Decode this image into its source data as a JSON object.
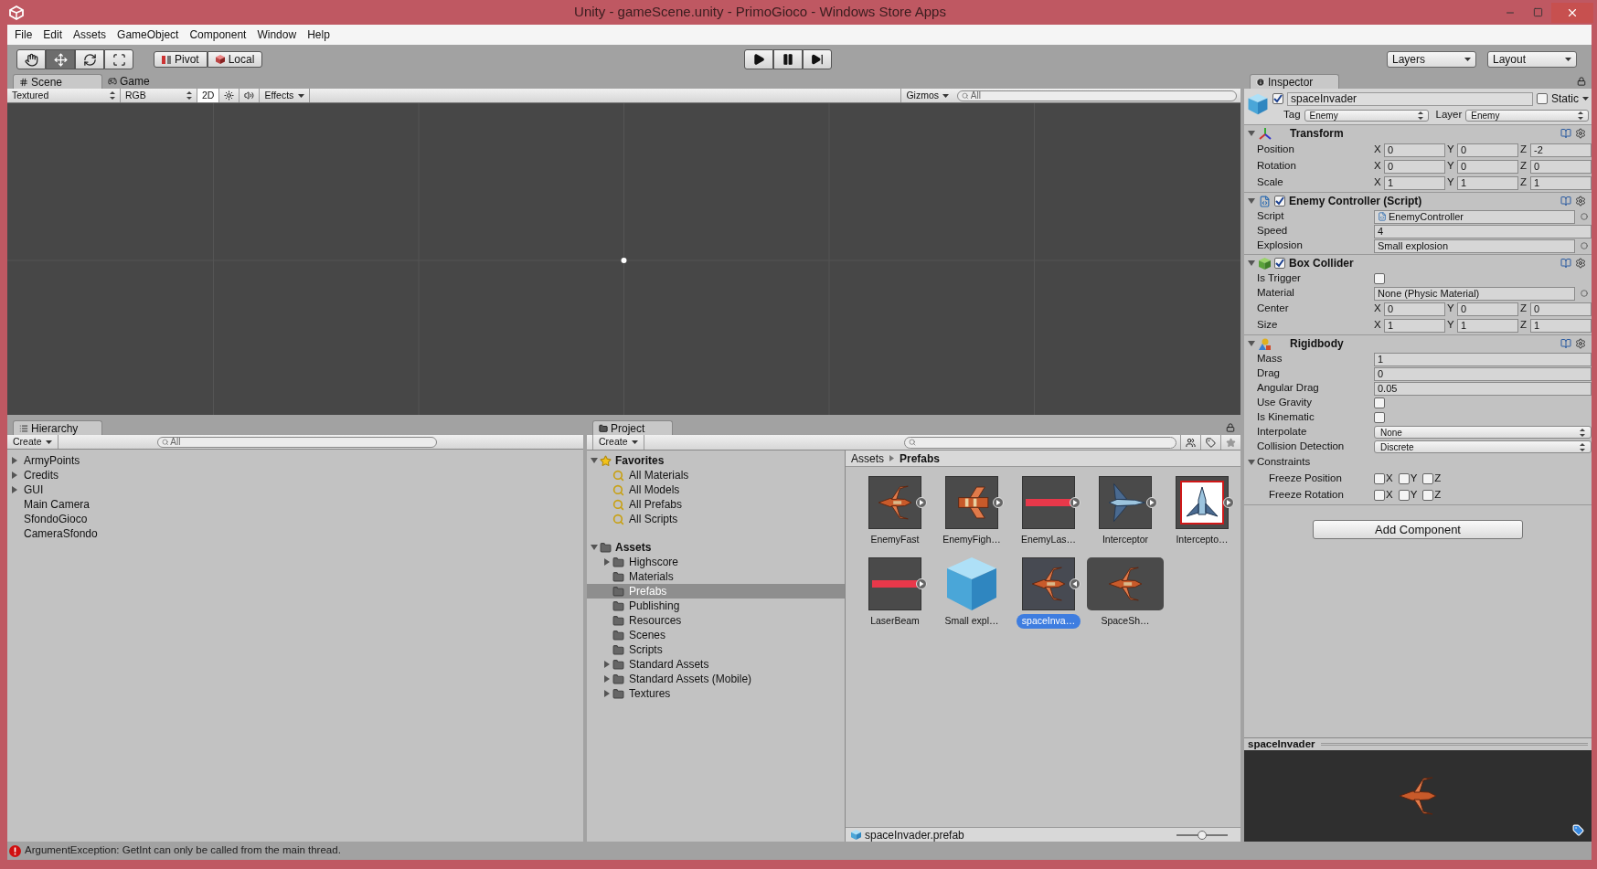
{
  "window": {
    "title": "Unity - gameScene.unity - PrimoGioco - Windows Store Apps"
  },
  "menu": [
    "File",
    "Edit",
    "Assets",
    "GameObject",
    "Component",
    "Window",
    "Help"
  ],
  "toolbar": {
    "tools": [
      {
        "kind": "hand",
        "selected": false
      },
      {
        "kind": "move",
        "selected": true
      },
      {
        "kind": "rotate",
        "selected": false
      },
      {
        "kind": "scale",
        "selected": false
      }
    ],
    "handles": [
      {
        "kind": "pivot",
        "label": "Pivot"
      },
      {
        "kind": "local",
        "label": "Local"
      }
    ],
    "playback": [
      {
        "kind": "play",
        "selected": false
      },
      {
        "kind": "pause",
        "selected": false
      },
      {
        "kind": "step",
        "selected": false
      }
    ],
    "layers": "Layers",
    "layout": "Layout"
  },
  "scene": {
    "tabs": [
      {
        "label": "Scene",
        "kind": "scene",
        "selected": true
      },
      {
        "label": "Game",
        "kind": "game",
        "selected": false
      }
    ],
    "shading": "Textured",
    "color_mode": "RGB",
    "mode_2d": {
      "label": "2D",
      "on": true
    },
    "lighting": {
      "on": false
    },
    "audio": {
      "on": false
    },
    "effects": "Effects",
    "gizmos": "Gizmos",
    "search_placeholder": "All"
  },
  "hierarchy": {
    "tab": "Hierarchy",
    "create": "Create",
    "search_placeholder": "All",
    "items": [
      {
        "label": "ArmyPoints",
        "has_children": true
      },
      {
        "label": "Credits",
        "has_children": true
      },
      {
        "label": "GUI",
        "has_children": true
      },
      {
        "label": "Main Camera",
        "has_children": false
      },
      {
        "label": "SfondoGioco",
        "has_children": false
      },
      {
        "label": "CameraSfondo",
        "has_children": false
      }
    ]
  },
  "project": {
    "tab": "Project",
    "create": "Create",
    "tree": [
      {
        "label": "Favorites",
        "kind": "favorites",
        "expanded": true,
        "children": [
          {
            "label": "All Materials",
            "kind": "search",
            "has_children": false,
            "selected": false
          },
          {
            "label": "All Models",
            "kind": "search",
            "has_children": false,
            "selected": false
          },
          {
            "label": "All Prefabs",
            "kind": "search",
            "has_children": false,
            "selected": false
          },
          {
            "label": "All Scripts",
            "kind": "search",
            "has_children": false,
            "selected": false
          }
        ]
      },
      {
        "label": "Assets",
        "kind": "folder",
        "expanded": true,
        "children": [
          {
            "label": "Highscore",
            "kind": "folder",
            "has_children": true,
            "selected": false
          },
          {
            "label": "Materials",
            "kind": "folder",
            "has_children": false,
            "selected": false
          },
          {
            "label": "Prefabs",
            "kind": "folder",
            "has_children": false,
            "selected": true
          },
          {
            "label": "Publishing",
            "kind": "folder",
            "has_children": false,
            "selected": false
          },
          {
            "label": "Resources",
            "kind": "folder",
            "has_children": false,
            "selected": false
          },
          {
            "label": "Scenes",
            "kind": "folder",
            "has_children": false,
            "selected": false
          },
          {
            "label": "Scripts",
            "kind": "folder",
            "has_children": false,
            "selected": false
          },
          {
            "label": "Standard Assets",
            "kind": "folder",
            "has_children": true,
            "selected": false
          },
          {
            "label": "Standard Assets (Mobile)",
            "kind": "folder",
            "has_children": true,
            "selected": false
          },
          {
            "label": "Textures",
            "kind": "folder",
            "has_children": true,
            "selected": false
          }
        ]
      }
    ],
    "breadcrumb": [
      "Assets",
      "Prefabs"
    ],
    "assets": [
      {
        "label": "EnemyFast",
        "kind": "ship_orange",
        "has_children": true,
        "expanded": false,
        "selected": false
      },
      {
        "label": "EnemyFigh…",
        "kind": "fighter",
        "has_children": true,
        "expanded": false,
        "selected": false
      },
      {
        "label": "EnemyLas…",
        "kind": "laser",
        "has_children": true,
        "expanded": false,
        "selected": false
      },
      {
        "label": "Interceptor",
        "kind": "ship_blue",
        "has_children": true,
        "expanded": false,
        "selected": false
      },
      {
        "label": "Intercepto…",
        "kind": "ship_blue_framed",
        "has_children": true,
        "expanded": false,
        "selected": false
      },
      {
        "label": "LaserBeam",
        "kind": "laser",
        "has_children": true,
        "expanded": false,
        "selected": false
      },
      {
        "label": "Small expl…",
        "kind": "cube",
        "has_children": false,
        "selected": false
      },
      {
        "label": "spaceInva…",
        "kind": "ship_orange",
        "has_children": true,
        "expanded": true,
        "selected": true
      },
      {
        "label": "SpaceSh…",
        "kind": "sub_ship",
        "has_children": false,
        "selected": false
      }
    ],
    "footer": {
      "file": "spaceInvader.prefab",
      "zoom": {
        "level": 0.5
      }
    }
  },
  "inspector": {
    "tab": "Inspector",
    "object": {
      "name": "spaceInvader",
      "active": true,
      "static_label": "Static",
      "static": false,
      "tag_label": "Tag",
      "tag": "Enemy",
      "layer_label": "Layer",
      "layer": "Enemy"
    },
    "components": [
      {
        "kind": "transform",
        "title": "Transform",
        "expanded": true,
        "fields": [
          {
            "kind": "vector3",
            "label": "Position",
            "axes": [
              {
                "label": "X",
                "value": "0"
              },
              {
                "label": "Y",
                "value": "0"
              },
              {
                "label": "Z",
                "value": "-2"
              }
            ]
          },
          {
            "kind": "vector3",
            "label": "Rotation",
            "axes": [
              {
                "label": "X",
                "value": "0"
              },
              {
                "label": "Y",
                "value": "0"
              },
              {
                "label": "Z",
                "value": "0"
              }
            ]
          },
          {
            "kind": "vector3",
            "label": "Scale",
            "axes": [
              {
                "label": "X",
                "value": "1"
              },
              {
                "label": "Y",
                "value": "1"
              },
              {
                "label": "Z",
                "value": "1"
              }
            ]
          }
        ]
      },
      {
        "kind": "script",
        "title": "Enemy Controller (Script)",
        "enabled": true,
        "expanded": true,
        "fields": [
          {
            "kind": "script_ref",
            "label": "Script",
            "value": "EnemyController"
          },
          {
            "kind": "text",
            "label": "Speed",
            "value": "4"
          },
          {
            "kind": "object",
            "label": "Explosion",
            "value": "Small explosion"
          }
        ]
      },
      {
        "kind": "collider",
        "title": "Box Collider",
        "enabled": true,
        "expanded": true,
        "fields": [
          {
            "kind": "checkbox",
            "label": "Is Trigger",
            "checked": false
          },
          {
            "kind": "object",
            "label": "Material",
            "value": "None (Physic Material)"
          },
          {
            "kind": "vector3",
            "label": "Center",
            "axes": [
              {
                "label": "X",
                "value": "0"
              },
              {
                "label": "Y",
                "value": "0"
              },
              {
                "label": "Z",
                "value": "0"
              }
            ]
          },
          {
            "kind": "vector3",
            "label": "Size",
            "axes": [
              {
                "label": "X",
                "value": "1"
              },
              {
                "label": "Y",
                "value": "1"
              },
              {
                "label": "Z",
                "value": "1"
              }
            ]
          }
        ]
      },
      {
        "kind": "rigidbody",
        "title": "Rigidbody",
        "expanded": true,
        "fields": [
          {
            "kind": "text",
            "label": "Mass",
            "value": "1"
          },
          {
            "kind": "text",
            "label": "Drag",
            "value": "0"
          },
          {
            "kind": "text",
            "label": "Angular Drag",
            "value": "0.05"
          },
          {
            "kind": "checkbox",
            "label": "Use Gravity",
            "checked": false
          },
          {
            "kind": "checkbox",
            "label": "Is Kinematic",
            "checked": false
          },
          {
            "kind": "dropdown",
            "label": "Interpolate",
            "value": "None"
          },
          {
            "kind": "dropdown",
            "label": "Collision Detection",
            "value": "Discrete"
          },
          {
            "kind": "group",
            "label": "Constraints",
            "expanded": true
          },
          {
            "kind": "flags",
            "label": "Freeze Position",
            "axes": [
              {
                "label": "X",
                "checked": false
              },
              {
                "label": "Y",
                "checked": false
              },
              {
                "label": "Z",
                "checked": false
              }
            ]
          },
          {
            "kind": "flags",
            "label": "Freeze Rotation",
            "axes": [
              {
                "label": "X",
                "checked": false
              },
              {
                "label": "Y",
                "checked": false
              },
              {
                "label": "Z",
                "checked": false
              }
            ]
          }
        ]
      }
    ],
    "add_component": "Add Component"
  },
  "preview": {
    "title": "spaceInvader"
  },
  "status": {
    "message": "ArgumentException: GetInt can only be called from the main thread."
  }
}
